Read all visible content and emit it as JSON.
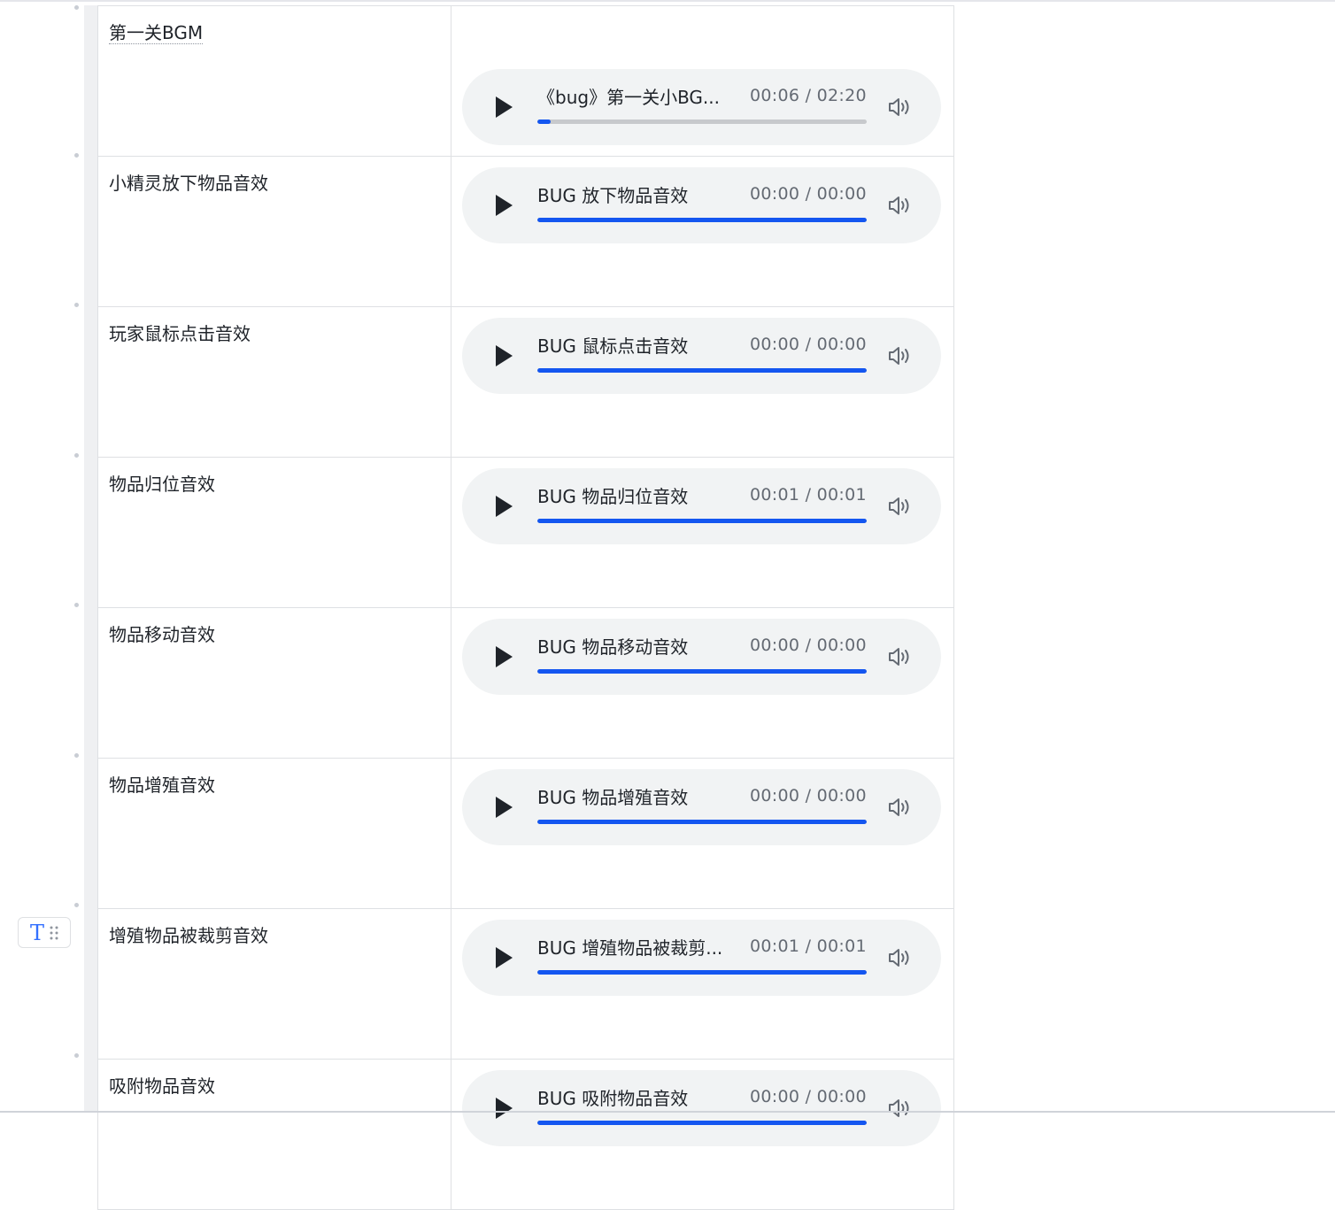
{
  "rows": [
    {
      "name": "第一关BGM",
      "track": "《bug》第一关小BG...",
      "time": "00:06 / 02:20",
      "progress": 0.04
    },
    {
      "name": "小精灵放下物品音效",
      "track": "BUG 放下物品音效",
      "time": "00:00 / 00:00",
      "progress": 1.0
    },
    {
      "name": "玩家鼠标点击音效",
      "track": "BUG 鼠标点击音效",
      "time": "00:00 / 00:00",
      "progress": 1.0
    },
    {
      "name": "物品归位音效",
      "track": "BUG 物品归位音效",
      "time": "00:01 / 00:01",
      "progress": 1.0
    },
    {
      "name": "物品移动音效",
      "track": "BUG 物品移动音效",
      "time": "00:00 / 00:00",
      "progress": 1.0
    },
    {
      "name": "物品增殖音效",
      "track": "BUG 物品增殖音效",
      "time": "00:00 / 00:00",
      "progress": 1.0
    },
    {
      "name": "增殖物品被裁剪音效",
      "track": "BUG 增殖物品被裁剪...",
      "time": "00:01 / 00:01",
      "progress": 1.0
    },
    {
      "name": "吸附物品音效",
      "track": "BUG 吸附物品音效",
      "time": "00:00 / 00:00",
      "progress": 1.0
    }
  ],
  "block_handle": {
    "type_glyph": "T",
    "type_icon": "text-type-icon",
    "drag_icon": "drag-grip-icon"
  },
  "colors": {
    "accent": "#1456f0",
    "player_bg": "#f1f3f4",
    "type_icon": "#3370ff"
  }
}
